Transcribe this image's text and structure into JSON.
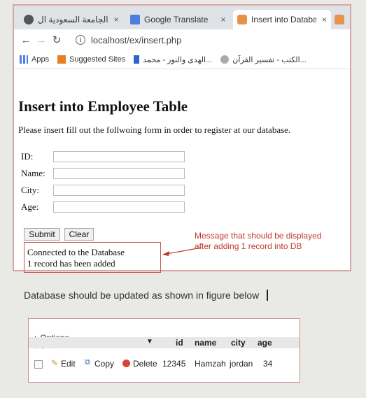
{
  "browser": {
    "tabs": [
      {
        "label": "الجامعة السعودية ال",
        "close": "×"
      },
      {
        "label": "Google Translate",
        "close": "×"
      },
      {
        "label": "Insert into Databa",
        "close": "×"
      }
    ],
    "address": "localhost/ex/insert.php",
    "bookmarks": [
      "Apps",
      "Suggested Sites",
      "الهدى والنور - محمد...",
      "الكتب - تفسير القرآن..."
    ]
  },
  "page": {
    "title": "Insert into Employee Table",
    "intro": "Please insert fill out the follwoing form in order to register at our database.",
    "fields": [
      {
        "label": "ID:",
        "value": ""
      },
      {
        "label": "Name:",
        "value": ""
      },
      {
        "label": "City:",
        "value": ""
      },
      {
        "label": "Age:",
        "value": ""
      }
    ],
    "submit_label": "Submit",
    "clear_label": "Clear",
    "message_line1": "Connected to the Database",
    "message_line2": "1 record has been added"
  },
  "annotation": "Message that should be displayed after adding 1 record into DB",
  "caption": "Database should be updated as shown in figure below",
  "db": {
    "options_label": "+ Options",
    "headers": [
      "id",
      "name",
      "city",
      "age"
    ],
    "actions": {
      "edit": "Edit",
      "copy": "Copy",
      "delete": "Delete"
    },
    "row": [
      "12345",
      "Hamzah",
      "jordan",
      "34"
    ]
  },
  "colors": {
    "accent_red": "#c0392b",
    "border_pink": "#d9a6a6"
  }
}
